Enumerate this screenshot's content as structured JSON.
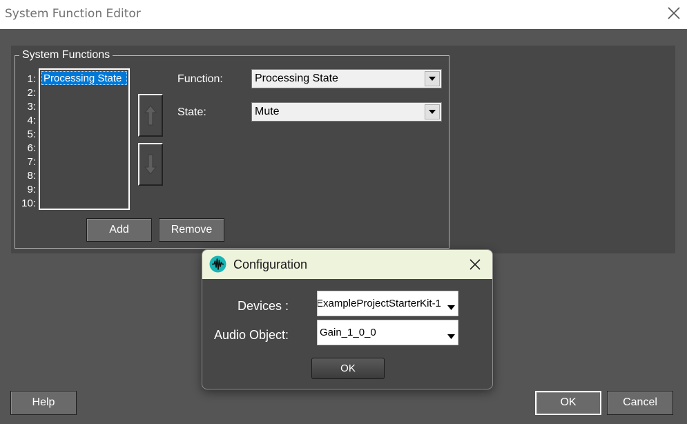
{
  "window": {
    "title": "System Function Editor"
  },
  "group": {
    "title": "System Functions",
    "row_numbers": [
      "1:",
      "2:",
      "3:",
      "4:",
      "5:",
      "6:",
      "7:",
      "8:",
      "9:",
      "10:"
    ],
    "list_items": [
      "Processing State"
    ],
    "add_label": "Add",
    "remove_label": "Remove"
  },
  "fields": {
    "function_label": "Function:",
    "function_value": "Processing State",
    "state_label": "State:",
    "state_value": "Mute"
  },
  "footer": {
    "help_label": "Help",
    "ok_label": "OK",
    "cancel_label": "Cancel"
  },
  "config_dialog": {
    "title": "Configuration",
    "devices_label": "Devices :",
    "devices_value": "ExampleProjectStarterKit-1",
    "audio_object_label": "Audio Object:",
    "audio_object_value": "Gain_1_0_0",
    "ok_label": "OK"
  },
  "colors": {
    "selection": "#0078d7",
    "dialog_header": "#eef3dc",
    "logo_accent": "#19b5b5"
  }
}
